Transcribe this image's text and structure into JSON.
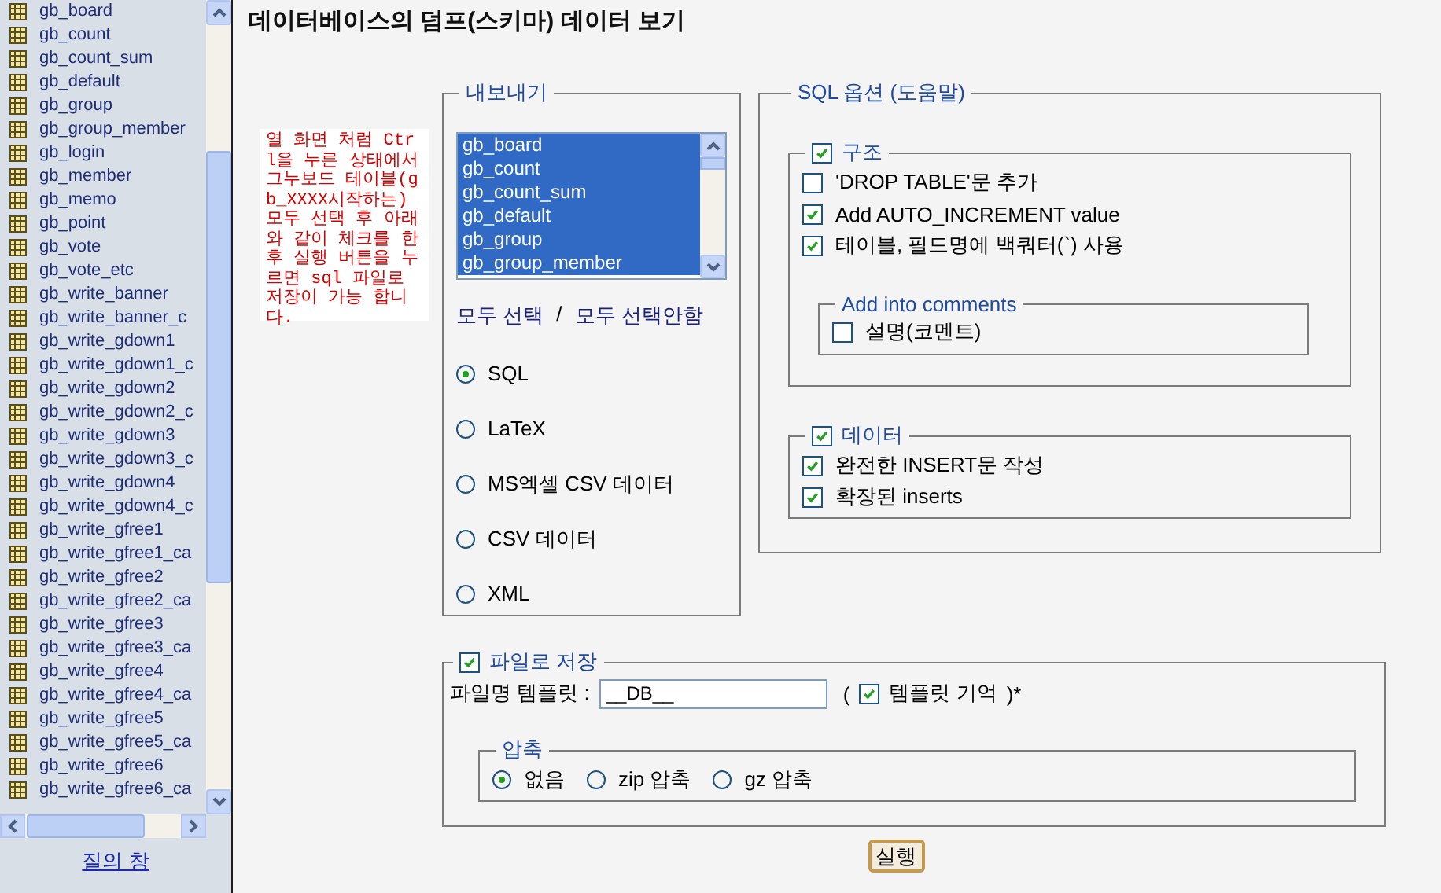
{
  "sidebar": {
    "tables": [
      {
        "name": "gb_board"
      },
      {
        "name": "gb_count"
      },
      {
        "name": "gb_count_sum"
      },
      {
        "name": "gb_default"
      },
      {
        "name": "gb_group"
      },
      {
        "name": "gb_group_member"
      },
      {
        "name": "gb_login"
      },
      {
        "name": "gb_member"
      },
      {
        "name": "gb_memo"
      },
      {
        "name": "gb_point"
      },
      {
        "name": "gb_vote"
      },
      {
        "name": "gb_vote_etc"
      },
      {
        "name": "gb_write_banner"
      },
      {
        "name": "gb_write_banner_c"
      },
      {
        "name": "gb_write_gdown1"
      },
      {
        "name": "gb_write_gdown1_c"
      },
      {
        "name": "gb_write_gdown2"
      },
      {
        "name": "gb_write_gdown2_c"
      },
      {
        "name": "gb_write_gdown3"
      },
      {
        "name": "gb_write_gdown3_c"
      },
      {
        "name": "gb_write_gdown4"
      },
      {
        "name": "gb_write_gdown4_c"
      },
      {
        "name": "gb_write_gfree1"
      },
      {
        "name": "gb_write_gfree1_ca"
      },
      {
        "name": "gb_write_gfree2"
      },
      {
        "name": "gb_write_gfree2_ca"
      },
      {
        "name": "gb_write_gfree3"
      },
      {
        "name": "gb_write_gfree3_ca"
      },
      {
        "name": "gb_write_gfree4"
      },
      {
        "name": "gb_write_gfree4_ca"
      },
      {
        "name": "gb_write_gfree5"
      },
      {
        "name": "gb_write_gfree5_ca"
      },
      {
        "name": "gb_write_gfree6"
      },
      {
        "name": "gb_write_gfree6_ca"
      }
    ],
    "query_window_link": "질의 창"
  },
  "title": "데이터베이스의 덤프(스키마) 데이터 보기",
  "note": "열 화면 처럼 Ctrl을 누른 상태에서 그누보드 테이블(gb_XXXX시작하는) 모두 선택 후 아래와 같이 체크를 한 후 실행 버튼을 누르면 sql 파일로 저장이 가능 합니다.",
  "export": {
    "legend": "내보내기",
    "tables": [
      {
        "name": "gb_board",
        "selected": true
      },
      {
        "name": "gb_count",
        "selected": true
      },
      {
        "name": "gb_count_sum",
        "selected": true
      },
      {
        "name": "gb_default",
        "selected": true
      },
      {
        "name": "gb_group",
        "selected": true
      },
      {
        "name": "gb_group_member",
        "selected": true
      }
    ],
    "select_all": "모두 선택",
    "separator": "/",
    "deselect_all": "모두 선택안함",
    "formats": [
      {
        "label": "SQL",
        "selected": true
      },
      {
        "label": "LaTeX",
        "selected": false
      },
      {
        "label": "MS엑셀 CSV 데이터",
        "selected": false
      },
      {
        "label": "CSV 데이터",
        "selected": false
      },
      {
        "label": "XML",
        "selected": false
      }
    ]
  },
  "sql_options": {
    "legend": "SQL 옵션 (도움말)",
    "structure": {
      "label": "구조",
      "checked": true,
      "options": [
        {
          "label": "'DROP TABLE'문 추가",
          "checked": false
        },
        {
          "label": "Add AUTO_INCREMENT value",
          "checked": true
        },
        {
          "label": "테이블, 필드명에 백쿼터(`) 사용",
          "checked": true
        }
      ],
      "comments": {
        "legend": "Add into comments",
        "options": [
          {
            "label": "설명(코멘트)",
            "checked": false
          }
        ]
      }
    },
    "data": {
      "label": "데이터",
      "checked": true,
      "options": [
        {
          "label": "완전한 INSERT문 작성",
          "checked": true
        },
        {
          "label": "확장된 inserts",
          "checked": true
        }
      ]
    }
  },
  "save_file": {
    "label": "파일로 저장",
    "checked": true,
    "filename_label": "파일명 템플릿 :",
    "filename_value": "__DB__",
    "open_paren": "(",
    "remember_label": "템플릿 기억",
    "remember_checked": true,
    "close_paren": ")*",
    "compression": {
      "legend": "압축",
      "options": [
        {
          "label": "없음",
          "selected": true
        },
        {
          "label": "zip 압축",
          "selected": false
        },
        {
          "label": "gz 압축",
          "selected": false
        }
      ]
    }
  },
  "submit": "실행"
}
